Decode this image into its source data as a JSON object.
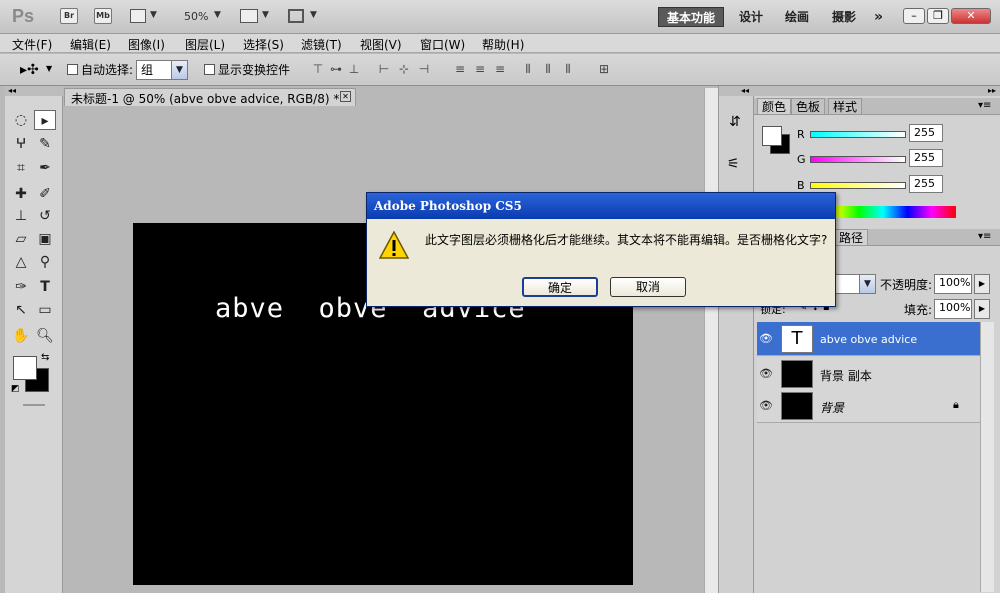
{
  "appbar": {
    "logo": "Ps",
    "bridge": "Br",
    "minibridge": "Mb",
    "zoom": "50%",
    "workspaces": [
      "基本功能",
      "设计",
      "绘画",
      "摄影"
    ],
    "more": "»"
  },
  "menubar": [
    "文件(F)",
    "编辑(E)",
    "图像(I)",
    "图层(L)",
    "选择(S)",
    "滤镜(T)",
    "视图(V)",
    "窗口(W)",
    "帮助(H)"
  ],
  "options": {
    "auto_select_label": "自动选择:",
    "auto_select_value": "组",
    "show_transform_label": "显示变换控件"
  },
  "document": {
    "tab_title": "未标题-1 @ 50% (abve  obve  advice, RGB/8) *",
    "text_content": "abve  obve  advice"
  },
  "color_panel": {
    "tabs": [
      "颜色",
      "色板",
      "样式"
    ],
    "channels": [
      {
        "label": "R",
        "value": "255"
      },
      {
        "label": "G",
        "value": "255"
      },
      {
        "label": "B",
        "value": "255"
      }
    ]
  },
  "layers_panel": {
    "tab": "路径",
    "opacity_label": "不透明度:",
    "opacity_value": "100%",
    "lock_label": "锁定:",
    "fill_label": "填充:",
    "fill_value": "100%",
    "layers": [
      {
        "name": "abve obve advice",
        "thumb": "T",
        "selected": true
      },
      {
        "name": "背景 副本",
        "thumb": "",
        "selected": false
      },
      {
        "name": "背景",
        "thumb": "",
        "selected": false
      }
    ]
  },
  "dialog": {
    "title": "Adobe Photoshop CS5",
    "message": "此文字图层必须栅格化后才能继续。其文本将不能再编辑。是否栅格化文字?",
    "ok_label": "确定",
    "cancel_label": "取消"
  }
}
